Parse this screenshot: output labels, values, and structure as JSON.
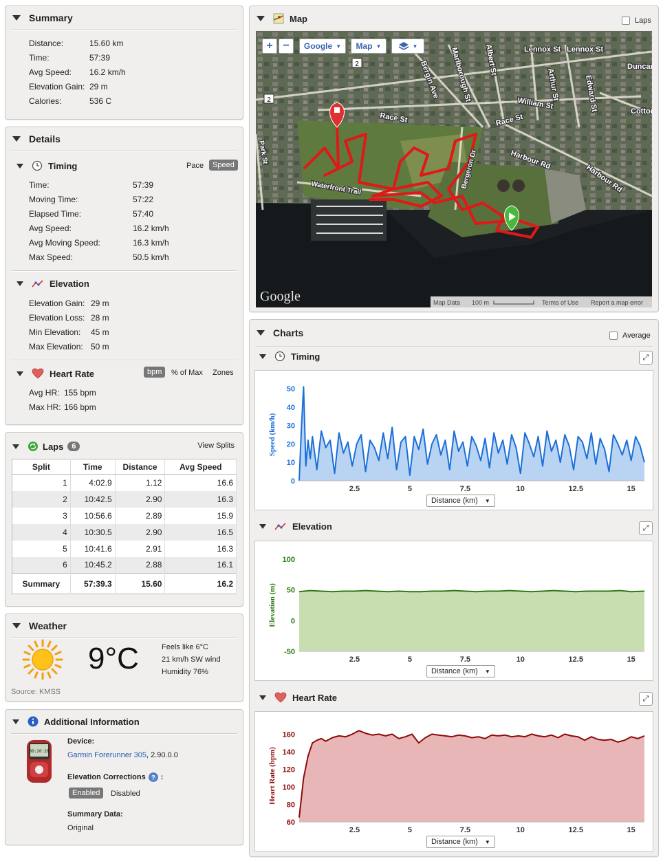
{
  "summary": {
    "title": "Summary",
    "rows": [
      {
        "label": "Distance:",
        "value": "15.60 km"
      },
      {
        "label": "Time:",
        "value": "57:39"
      },
      {
        "label": "Avg Speed:",
        "value": "16.2 km/h"
      },
      {
        "label": "Elevation Gain:",
        "value": "29 m"
      },
      {
        "label": "Calories:",
        "value": "536 C"
      }
    ]
  },
  "details": {
    "title": "Details",
    "timing": {
      "title": "Timing",
      "pace_label": "Pace",
      "speed_label": "Speed",
      "rows": [
        {
          "label": "Time:",
          "value": "57:39"
        },
        {
          "label": "Moving Time:",
          "value": "57:22"
        },
        {
          "label": "Elapsed Time:",
          "value": "57:40"
        },
        {
          "label": "Avg Speed:",
          "value": "16.2 km/h"
        },
        {
          "label": "Avg Moving Speed:",
          "value": "16.3 km/h"
        },
        {
          "label": "Max Speed:",
          "value": "50.5 km/h"
        }
      ]
    },
    "elevation": {
      "title": "Elevation",
      "rows": [
        {
          "label": "Elevation Gain:",
          "value": "29 m"
        },
        {
          "label": "Elevation Loss:",
          "value": "28 m"
        },
        {
          "label": "Min Elevation:",
          "value": "45 m"
        },
        {
          "label": "Max Elevation:",
          "value": "50 m"
        }
      ]
    },
    "heartrate": {
      "title": "Heart Rate",
      "bpm_label": "bpm",
      "pct_label": "% of Max",
      "zones_label": "Zones",
      "rows": [
        {
          "label": "Avg HR:",
          "value": "155 bpm"
        },
        {
          "label": "Max HR:",
          "value": "166 bpm"
        }
      ]
    }
  },
  "laps": {
    "title": "Laps",
    "count": "6",
    "view_splits": "View Splits",
    "headers": [
      "Split",
      "Time",
      "Distance",
      "Avg Speed"
    ],
    "rows": [
      [
        "1",
        "4:02.9",
        "1.12",
        "16.6"
      ],
      [
        "2",
        "10:42.5",
        "2.90",
        "16.3"
      ],
      [
        "3",
        "10:56.6",
        "2.89",
        "15.9"
      ],
      [
        "4",
        "10:30.5",
        "2.90",
        "16.5"
      ],
      [
        "5",
        "10:41.6",
        "2.91",
        "16.3"
      ],
      [
        "6",
        "10:45.2",
        "2.88",
        "16.1"
      ]
    ],
    "summary": [
      "Summary",
      "57:39.3",
      "15.60",
      "16.2"
    ]
  },
  "weather": {
    "title": "Weather",
    "temp": "9°C",
    "feels": "Feels like 6°C",
    "wind": "21 km/h SW wind",
    "humidity": "Humidity 76%",
    "source": "Source: KMSS"
  },
  "additional": {
    "title": "Additional Information",
    "device_label": "Device:",
    "device_name": "Garmin Forerunner 305",
    "device_version": ", 2.90.0.0",
    "elev_corr_label": "Elevation Corrections",
    "elev_corr_colon": ":",
    "enabled": "Enabled",
    "disabled": "Disabled",
    "summary_label": "Summary Data:",
    "summary_value": "Original",
    "device_screen": "00:20:28"
  },
  "map": {
    "title": "Map",
    "laps_label": "Laps",
    "google_btn": "Google",
    "map_btn": "Map",
    "zoom_in": "+",
    "zoom_out": "−",
    "logo": "Google",
    "footer": {
      "map_data": "Map Data",
      "scale": "100 m",
      "terms": "Terms of Use",
      "report": "Report a map error"
    },
    "labels": {
      "race_st": "Race St",
      "race_st2": "Race St",
      "william_st": "William St",
      "harbour_rd": "Harbour Rd",
      "harbour_rd2": "Harbour Rd",
      "bergin_ave": "Bergin Ave",
      "marlborough": "Marlborough St",
      "albert": "Albert St",
      "arthur": "Arthur St",
      "edward": "Edward St",
      "lennox1": "Lennox St",
      "lennox2": "Lennox St",
      "duncan": "Duncan",
      "cotton": "Cotton",
      "waterfront": "Waterfront Trail",
      "bergeron": "Bergeron Dr",
      "park": "Park St",
      "route2": "2",
      "route2b": "2"
    }
  },
  "charts": {
    "title": "Charts",
    "average_label": "Average",
    "xlabel_select": "Distance (km)",
    "timing": {
      "title": "Timing"
    },
    "elevation": {
      "title": "Elevation"
    },
    "heartrate": {
      "title": "Heart Rate"
    }
  },
  "chart_data": [
    {
      "type": "area",
      "title": "Timing",
      "ylabel": "Speed (km/h)",
      "xlabel": "Distance (km)",
      "xlim": [
        0,
        15.6
      ],
      "ylim": [
        0,
        50
      ],
      "yticks": [
        0,
        10,
        20,
        30,
        40,
        50
      ],
      "xticks": [
        2.5,
        5,
        7.5,
        10,
        12.5,
        15
      ],
      "color": "#1a6fd8",
      "fill": "#b9d3f3",
      "x": [
        0,
        0.1,
        0.2,
        0.3,
        0.4,
        0.5,
        0.6,
        0.8,
        1.0,
        1.2,
        1.4,
        1.6,
        1.8,
        2.0,
        2.2,
        2.4,
        2.6,
        2.8,
        3.0,
        3.2,
        3.4,
        3.6,
        3.8,
        4.0,
        4.2,
        4.4,
        4.6,
        4.8,
        5.0,
        5.2,
        5.4,
        5.6,
        5.8,
        6.0,
        6.2,
        6.4,
        6.6,
        6.8,
        7.0,
        7.2,
        7.4,
        7.6,
        7.8,
        8.0,
        8.2,
        8.4,
        8.6,
        8.8,
        9.0,
        9.2,
        9.4,
        9.6,
        9.8,
        10.0,
        10.2,
        10.4,
        10.6,
        10.8,
        11.0,
        11.2,
        11.4,
        11.6,
        11.8,
        12.0,
        12.2,
        12.4,
        12.6,
        12.8,
        13.0,
        13.2,
        13.4,
        13.6,
        13.8,
        14.0,
        14.2,
        14.4,
        14.6,
        14.8,
        15.0,
        15.2,
        15.4,
        15.6
      ],
      "y": [
        0,
        28,
        51,
        8,
        22,
        12,
        24,
        6,
        27,
        18,
        22,
        4,
        26,
        15,
        21,
        8,
        20,
        25,
        5,
        22,
        18,
        11,
        26,
        12,
        29,
        6,
        21,
        24,
        3,
        24,
        17,
        28,
        9,
        20,
        25,
        14,
        22,
        6,
        27,
        16,
        21,
        8,
        24,
        19,
        11,
        23,
        7,
        26,
        15,
        22,
        9,
        25,
        18,
        4,
        26,
        20,
        13,
        24,
        8,
        27,
        16,
        22,
        10,
        25,
        19,
        6,
        24,
        21,
        12,
        26,
        9,
        23,
        17,
        5,
        25,
        20,
        14,
        22,
        11,
        24,
        19,
        10
      ]
    },
    {
      "type": "area",
      "title": "Elevation",
      "ylabel": "Elevation (m)",
      "xlabel": "Distance (km)",
      "xlim": [
        0,
        15.6
      ],
      "ylim": [
        -50,
        100
      ],
      "yticks": [
        -50,
        0,
        50,
        100
      ],
      "xticks": [
        2.5,
        5,
        7.5,
        10,
        12.5,
        15
      ],
      "color": "#2d7a12",
      "fill": "#c8deb0",
      "x": [
        0,
        0.5,
        1,
        1.5,
        2,
        2.5,
        3,
        3.5,
        4,
        4.5,
        5,
        5.5,
        6,
        6.5,
        7,
        7.5,
        8,
        8.5,
        9,
        9.5,
        10,
        10.5,
        11,
        11.5,
        12,
        12.5,
        13,
        13.5,
        14,
        14.5,
        15,
        15.6
      ],
      "y": [
        47,
        49,
        48,
        47,
        48,
        48,
        49,
        48,
        47,
        48,
        47,
        47,
        48,
        48,
        49,
        48,
        47,
        48,
        48,
        49,
        48,
        47,
        48,
        49,
        48,
        47,
        48,
        48,
        48,
        49,
        47,
        48
      ]
    },
    {
      "type": "area",
      "title": "Heart Rate",
      "ylabel": "Heart Rate (bpm)",
      "xlabel": "Distance (km)",
      "xlim": [
        0,
        15.6
      ],
      "ylim": [
        60,
        165
      ],
      "yticks": [
        60,
        80,
        100,
        120,
        140,
        160
      ],
      "xticks": [
        2.5,
        5,
        7.5,
        10,
        12.5,
        15
      ],
      "color": "#8b0a0a",
      "fill": "#e8b6b6",
      "x": [
        0,
        0.2,
        0.4,
        0.6,
        0.8,
        1.0,
        1.2,
        1.5,
        1.8,
        2.1,
        2.4,
        2.7,
        3.0,
        3.3,
        3.6,
        3.9,
        4.2,
        4.5,
        4.8,
        5.1,
        5.4,
        5.7,
        6.0,
        6.3,
        6.6,
        6.9,
        7.2,
        7.5,
        7.8,
        8.1,
        8.4,
        8.7,
        9.0,
        9.3,
        9.6,
        9.9,
        10.2,
        10.5,
        10.8,
        11.1,
        11.4,
        11.7,
        12.0,
        12.3,
        12.6,
        12.9,
        13.2,
        13.5,
        13.8,
        14.1,
        14.4,
        14.7,
        15.0,
        15.3,
        15.6
      ],
      "y": [
        65,
        110,
        135,
        150,
        153,
        155,
        152,
        156,
        158,
        157,
        160,
        164,
        161,
        159,
        160,
        158,
        160,
        155,
        157,
        160,
        150,
        156,
        160,
        159,
        158,
        157,
        159,
        158,
        156,
        157,
        155,
        159,
        158,
        159,
        157,
        158,
        157,
        160,
        158,
        157,
        159,
        156,
        160,
        158,
        157,
        153,
        157,
        154,
        153,
        154,
        151,
        153,
        157,
        155,
        158
      ]
    }
  ]
}
